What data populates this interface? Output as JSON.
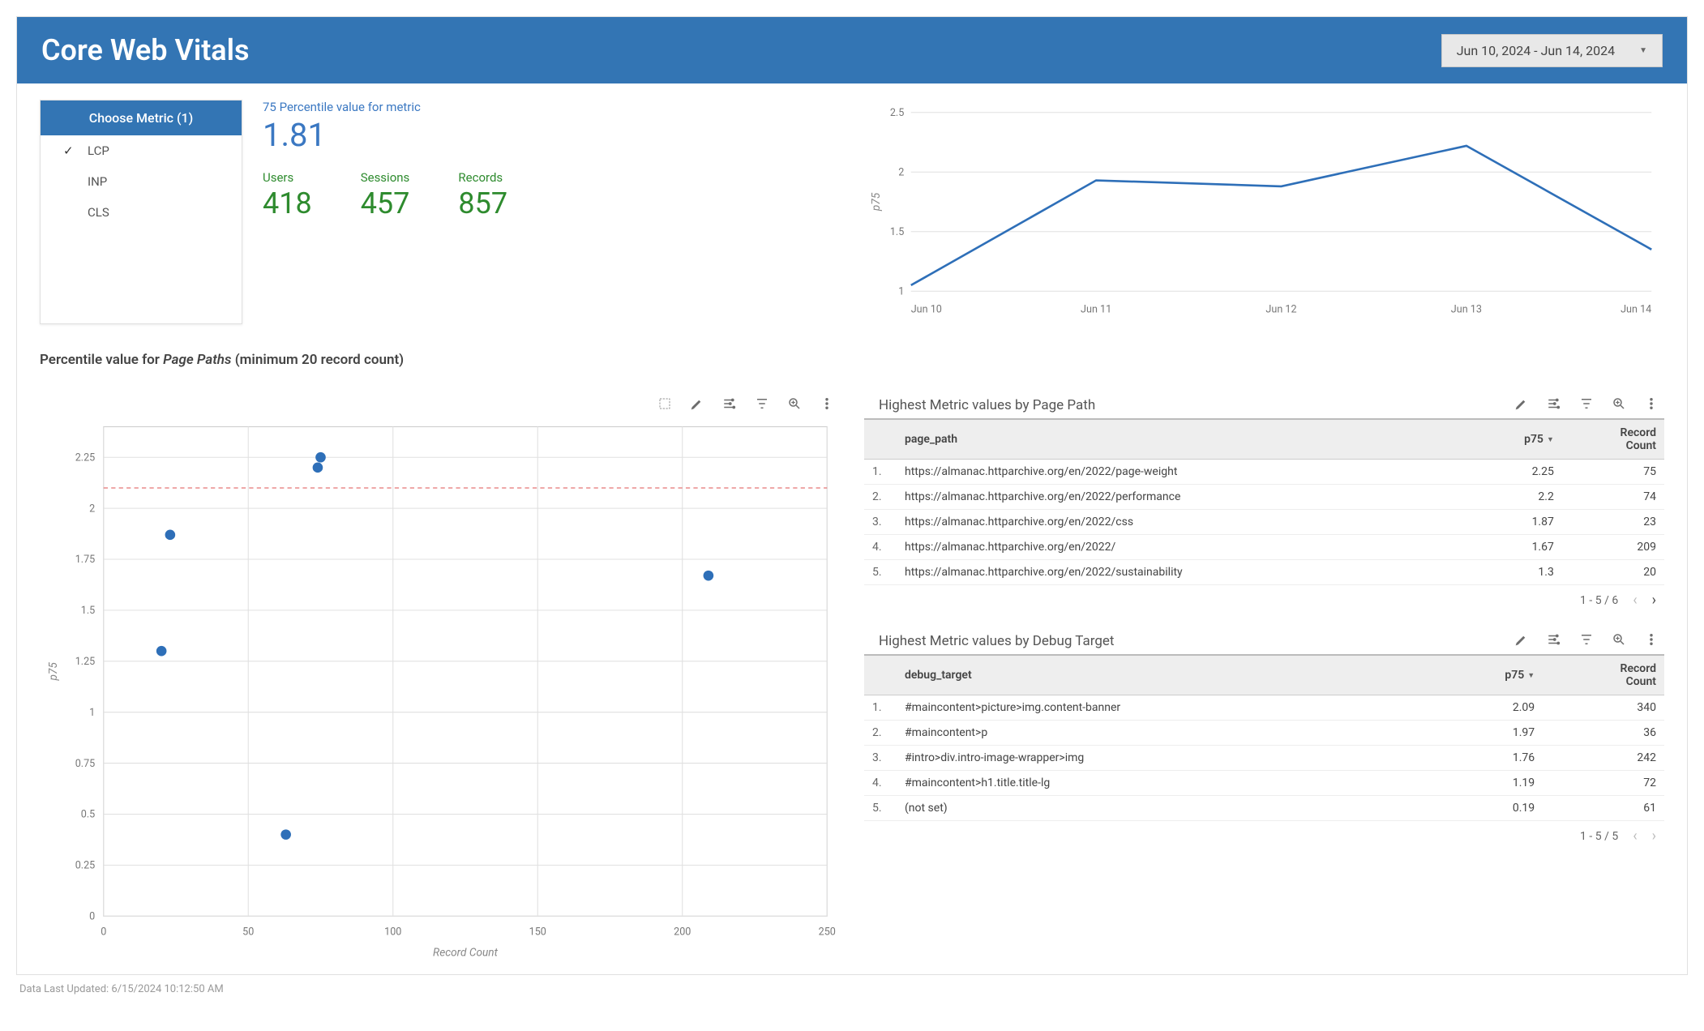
{
  "header": {
    "title": "Core Web Vitals",
    "date_range": "Jun 10, 2024 - Jun 14, 2024"
  },
  "metric_selector": {
    "title": "Choose Metric (1)",
    "items": [
      "LCP",
      "INP",
      "CLS"
    ],
    "selected": "LCP"
  },
  "kpi": {
    "percentile_label": "75 Percentile value for metric",
    "percentile_value": "1.81",
    "metrics": [
      {
        "label": "Users",
        "value": "418"
      },
      {
        "label": "Sessions",
        "value": "457"
      },
      {
        "label": "Records",
        "value": "857"
      }
    ]
  },
  "section_title_prefix": "Percentile value for ",
  "section_title_em": "Page Paths",
  "section_title_suffix": " (minimum 20 record count)",
  "footer": "Data Last Updated: 6/15/2024 10:12:50 AM",
  "table_page_path": {
    "title": "Highest Metric values by Page Path",
    "columns": {
      "path": "page_path",
      "p75": "p75",
      "count_l1": "Record",
      "count_l2": "Count"
    },
    "rows": [
      {
        "idx": "1.",
        "path": "https://almanac.httparchive.org/en/2022/page-weight",
        "p75": "2.25",
        "count": "75"
      },
      {
        "idx": "2.",
        "path": "https://almanac.httparchive.org/en/2022/performance",
        "p75": "2.2",
        "count": "74"
      },
      {
        "idx": "3.",
        "path": "https://almanac.httparchive.org/en/2022/css",
        "p75": "1.87",
        "count": "23"
      },
      {
        "idx": "4.",
        "path": "https://almanac.httparchive.org/en/2022/",
        "p75": "1.67",
        "count": "209"
      },
      {
        "idx": "5.",
        "path": "https://almanac.httparchive.org/en/2022/sustainability",
        "p75": "1.3",
        "count": "20"
      }
    ],
    "pager": "1 - 5 / 6"
  },
  "table_debug_target": {
    "title": "Highest Metric values by Debug Target",
    "columns": {
      "target": "debug_target",
      "p75": "p75",
      "count_l1": "Record",
      "count_l2": "Count"
    },
    "rows": [
      {
        "idx": "1.",
        "target": "#maincontent>picture>img.content-banner",
        "p75": "2.09",
        "count": "340"
      },
      {
        "idx": "2.",
        "target": "#maincontent>p",
        "p75": "1.97",
        "count": "36"
      },
      {
        "idx": "3.",
        "target": "#intro>div.intro-image-wrapper>img",
        "p75": "1.76",
        "count": "242"
      },
      {
        "idx": "4.",
        "target": "#maincontent>h1.title.title-lg",
        "p75": "1.19",
        "count": "72"
      },
      {
        "idx": "5.",
        "target": "(not set)",
        "p75": "0.19",
        "count": "61"
      }
    ],
    "pager": "1 - 5 / 5"
  },
  "chart_data": [
    {
      "id": "trend_line",
      "type": "line",
      "categories": [
        "Jun 10",
        "Jun 11",
        "Jun 12",
        "Jun 13",
        "Jun 14"
      ],
      "values": [
        1.05,
        1.93,
        1.88,
        2.22,
        1.35
      ],
      "ylabel": "p75",
      "ylim": [
        1,
        2.5
      ],
      "yticks": [
        1,
        1.5,
        2,
        2.5
      ]
    },
    {
      "id": "scatter_paths",
      "type": "scatter",
      "xlabel": "Record Count",
      "ylabel": "p75",
      "xlim": [
        0,
        250
      ],
      "ylim": [
        0,
        2.4
      ],
      "xticks": [
        0,
        50,
        100,
        150,
        200,
        250
      ],
      "yticks": [
        0,
        0.25,
        0.5,
        0.75,
        1,
        1.25,
        1.5,
        1.75,
        2,
        2.25
      ],
      "reference_line_y": 2.1,
      "points": [
        {
          "x": 75,
          "y": 2.25
        },
        {
          "x": 74,
          "y": 2.2
        },
        {
          "x": 23,
          "y": 1.87
        },
        {
          "x": 209,
          "y": 1.67
        },
        {
          "x": 20,
          "y": 1.3
        },
        {
          "x": 63,
          "y": 0.4
        }
      ]
    }
  ]
}
